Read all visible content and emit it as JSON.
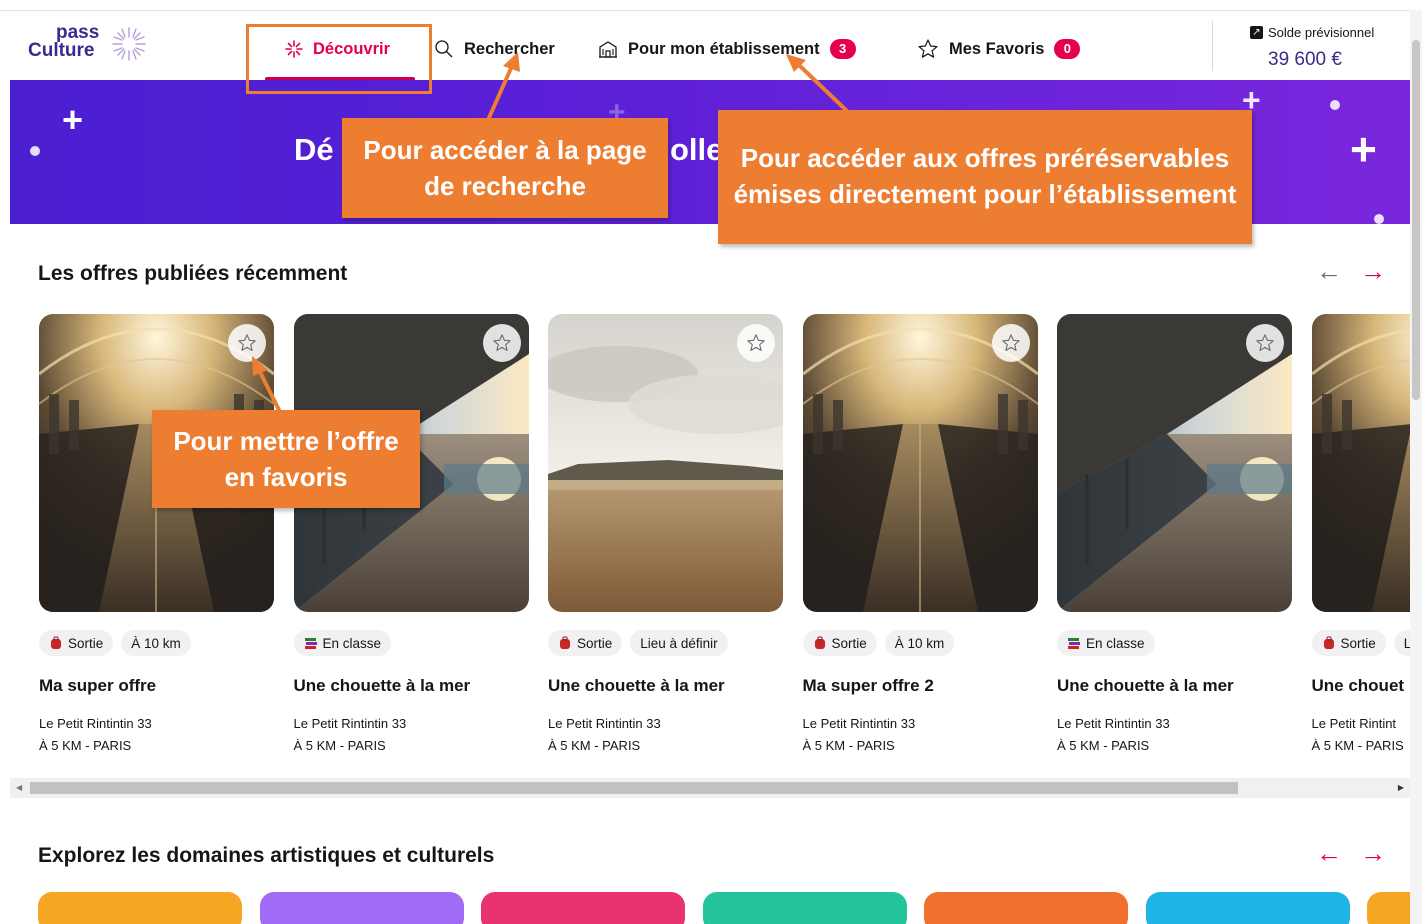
{
  "header": {
    "logo_pass": "pass",
    "logo_culture": "Culture",
    "nav": [
      {
        "label": "Découvrir",
        "icon": "sparkle-icon",
        "active": true
      },
      {
        "label": "Rechercher",
        "icon": "search-icon"
      },
      {
        "label": "Pour mon établissement",
        "icon": "school-icon",
        "badge": "3"
      },
      {
        "label": "Mes Favoris",
        "icon": "star-icon",
        "badge": "0"
      }
    ],
    "solde_label": "Solde prévisionnel",
    "solde_value": "39 600 €"
  },
  "banner": {
    "title_left": "Dé",
    "title_right": "olle"
  },
  "annotations": {
    "search": "Pour accéder à la page de recherche",
    "establishment": "Pour accéder aux offres préréservables émises directement pour l’établissement",
    "favorite": "Pour mettre l’offre en favoris"
  },
  "recent": {
    "title": "Les offres publiées récemment",
    "cards": [
      {
        "tags": [
          {
            "label": "Sortie",
            "icon": "backpack-icon"
          },
          {
            "label": "À 10 km"
          }
        ],
        "title": "Ma super offre",
        "venue": "Le Petit Rintintin 33",
        "location": "À 5 KM - PARIS",
        "image": "tunnel"
      },
      {
        "tags": [
          {
            "label": "En classe",
            "icon": "books-icon"
          }
        ],
        "title": "Une chouette à la mer",
        "venue": "Le Petit Rintintin 33",
        "location": "À 5 KM - PARIS",
        "image": "station"
      },
      {
        "tags": [
          {
            "label": "Sortie",
            "icon": "backpack-icon"
          },
          {
            "label": "Lieu à définir"
          }
        ],
        "title": "Une chouette à la mer",
        "venue": "Le Petit Rintintin 33",
        "location": "À 5 KM - PARIS",
        "image": "sea"
      },
      {
        "tags": [
          {
            "label": "Sortie",
            "icon": "backpack-icon"
          },
          {
            "label": "À 10 km"
          }
        ],
        "title": "Ma super offre 2",
        "venue": "Le Petit Rintintin 33",
        "location": "À 5 KM - PARIS",
        "image": "tunnel"
      },
      {
        "tags": [
          {
            "label": "En classe",
            "icon": "books-icon"
          }
        ],
        "title": "Une chouette à la mer",
        "venue": "Le Petit Rintintin 33",
        "location": "À 5 KM - PARIS",
        "image": "station"
      },
      {
        "tags": [
          {
            "label": "Sortie",
            "icon": "backpack-icon"
          },
          {
            "label": "L"
          }
        ],
        "title": "Une chouet",
        "venue": "Le Petit Rintint",
        "location": "À 5 KM - PARIS",
        "image": "tunnel"
      }
    ]
  },
  "domains": {
    "title": "Explorez les domaines artistiques et culturels",
    "tiles": [
      {
        "color": "#f5a623"
      },
      {
        "color": "#a06bf5"
      },
      {
        "color": "#e8336e"
      },
      {
        "color": "#23c49b"
      },
      {
        "color": "#f0702e"
      },
      {
        "color": "#1eb5e6"
      },
      {
        "color": "#f5a623"
      }
    ]
  },
  "colors": {
    "accent": "#e5004e",
    "brand_purple": "#3b2b8c",
    "annotation_orange": "#ed7d31"
  }
}
